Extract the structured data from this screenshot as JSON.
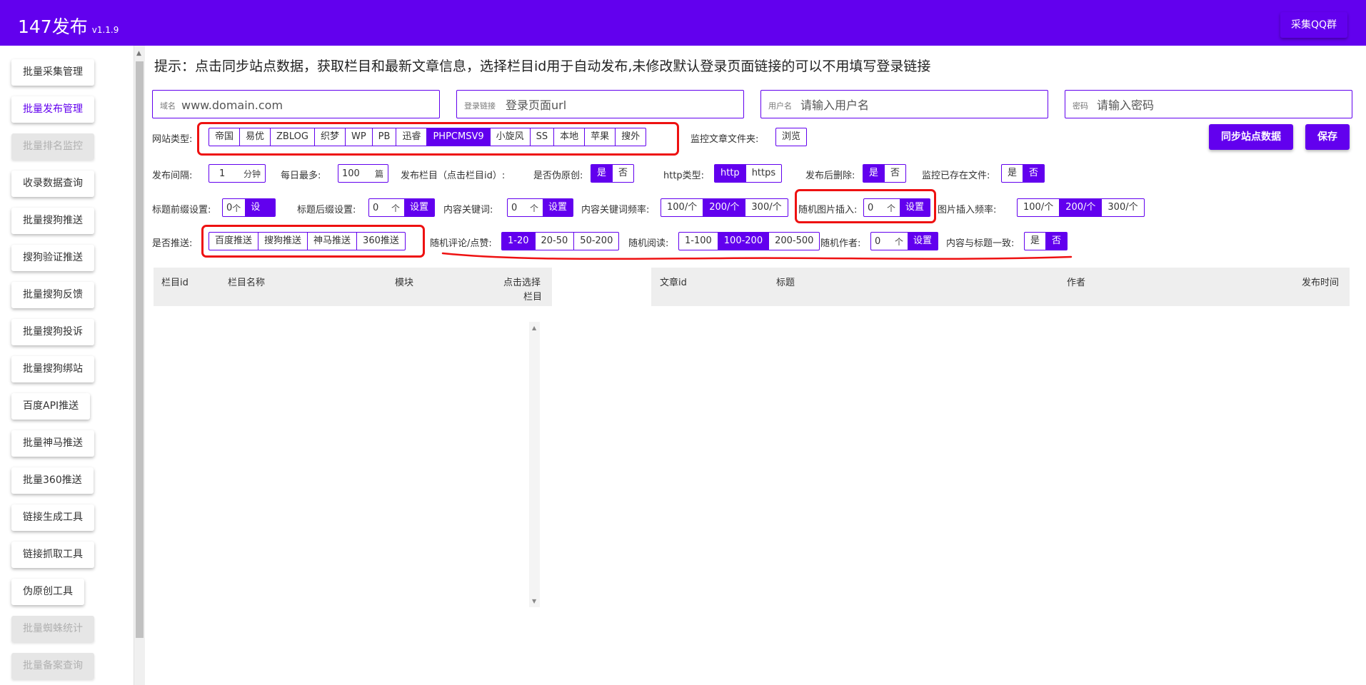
{
  "header": {
    "title": "147发布",
    "version": "v1.1.9",
    "qq_button": "采集QQ群"
  },
  "sidebar": {
    "items": [
      {
        "label": "批量采集管理",
        "state": "normal"
      },
      {
        "label": "批量发布管理",
        "state": "active"
      },
      {
        "label": "批量排名监控",
        "state": "disabled"
      },
      {
        "label": "收录数据查询",
        "state": "normal"
      },
      {
        "label": "批量搜狗推送",
        "state": "normal"
      },
      {
        "label": "搜狗验证推送",
        "state": "normal"
      },
      {
        "label": "批量搜狗反馈",
        "state": "normal"
      },
      {
        "label": "批量搜狗投诉",
        "state": "normal"
      },
      {
        "label": "批量搜狗绑站",
        "state": "normal"
      },
      {
        "label": "百度API推送",
        "state": "normal"
      },
      {
        "label": "批量神马推送",
        "state": "normal"
      },
      {
        "label": "批量360推送",
        "state": "normal"
      },
      {
        "label": "链接生成工具",
        "state": "normal"
      },
      {
        "label": "链接抓取工具",
        "state": "normal"
      },
      {
        "label": "伪原创工具",
        "state": "normal"
      },
      {
        "label": "批量蜘蛛统计",
        "state": "disabled"
      },
      {
        "label": "批量备案查询",
        "state": "disabled"
      }
    ]
  },
  "hint": "提示：点击同步站点数据，获取栏目和最新文章信息，选择栏目id用于自动发布,未修改默认登录页面链接的可以不用填写登录链接",
  "fields": {
    "domain": {
      "label": "域名",
      "placeholder": "www.domain.com"
    },
    "login": {
      "label": "登录链接",
      "placeholder": "登录页面url"
    },
    "user": {
      "label": "用户名",
      "placeholder": "请输入用户名"
    },
    "pwd": {
      "label": "密码",
      "placeholder": "请输入密码"
    }
  },
  "site_type": {
    "label": "网站类型:",
    "options": [
      "帝国",
      "易优",
      "ZBLOG",
      "织梦",
      "WP",
      "PB",
      "迅睿",
      "PHPCMSV9",
      "小旋风",
      "SS",
      "本地",
      "苹果",
      "搜外"
    ],
    "selected": "PHPCMSV9"
  },
  "monitor_folder": {
    "label": "监控文章文件夹:",
    "button": "浏览"
  },
  "actions": {
    "sync": "同步站点数据",
    "save": "保存"
  },
  "row2": {
    "interval": {
      "label": "发布间隔:",
      "value": "1",
      "unit": "分钟"
    },
    "daily_max": {
      "label": "每日最多:",
      "value": "100",
      "unit": "篇"
    },
    "column_label": "发布栏目（点击栏目id）:",
    "pseudo": {
      "label": "是否伪原创:",
      "options": [
        "是",
        "否"
      ],
      "selected": "是"
    },
    "http": {
      "label": "http类型:",
      "options": [
        "http",
        "https"
      ],
      "selected": "http"
    },
    "delete_after": {
      "label": "发布后删除:",
      "options": [
        "是",
        "否"
      ],
      "selected": "是"
    },
    "monitor_exist": {
      "label": "监控已存在文件:",
      "options": [
        "是",
        "否"
      ],
      "selected": "否"
    }
  },
  "row3": {
    "title_prefix": {
      "label": "标题前缀设置:",
      "value": "0",
      "unit": "个",
      "button": "设置"
    },
    "title_suffix": {
      "label": "标题后缀设置:",
      "value": "0",
      "unit": "个",
      "button": "设置"
    },
    "keywords": {
      "label": "内容关键词:",
      "value": "0",
      "unit": "个",
      "button": "设置"
    },
    "kw_freq": {
      "label": "内容关键词频率:",
      "options": [
        "100/个",
        "200/个",
        "300/个"
      ],
      "selected": "200/个"
    },
    "rand_img": {
      "label": "随机图片插入:",
      "value": "0",
      "unit": "个",
      "button": "设置"
    },
    "img_freq": {
      "label": "图片插入频率:",
      "options": [
        "100/个",
        "200/个",
        "300/个"
      ],
      "selected": "200/个"
    }
  },
  "row4": {
    "push": {
      "label": "是否推送:",
      "options": [
        "百度推送",
        "搜狗推送",
        "神马推送",
        "360推送"
      ]
    },
    "comments": {
      "label": "随机评论/点赞:",
      "options": [
        "1-20",
        "20-50",
        "50-200"
      ],
      "selected": "1-20"
    },
    "reads": {
      "label": "随机阅读:",
      "options": [
        "1-100",
        "100-200",
        "200-500"
      ],
      "selected": "100-200"
    },
    "author": {
      "label": "随机作者:",
      "value": "0",
      "unit": "个",
      "button": "设置"
    },
    "content_title": {
      "label": "内容与标题一致:",
      "options": [
        "是",
        "否"
      ],
      "selected": "否"
    }
  },
  "column_table": {
    "headers": [
      "栏目id",
      "栏目名称",
      "模块",
      "点击选择",
      "栏目"
    ]
  },
  "article_table": {
    "headers": [
      "文章id",
      "标题",
      "作者",
      "发布时间"
    ]
  },
  "colors": {
    "accent": "#6200ee",
    "annotation": "#ee1111"
  }
}
